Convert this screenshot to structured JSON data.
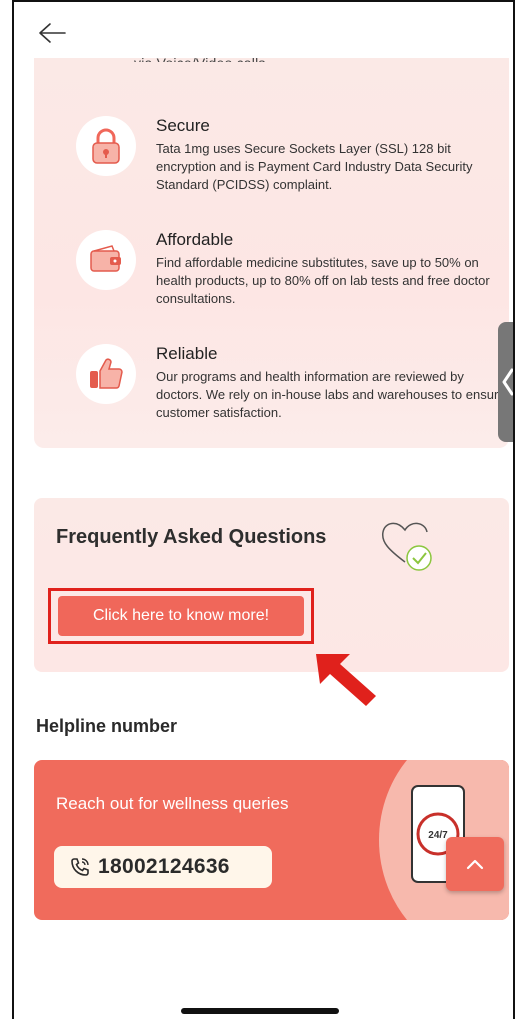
{
  "cutoff_text": "via Voice/Video calls.",
  "features": [
    {
      "icon": "lock-icon",
      "title": "Secure",
      "desc": "Tata 1mg uses Secure Sockets Layer (SSL) 128 bit encryption and is Payment Card Industry Data Security Standard (PCIDSS) complaint."
    },
    {
      "icon": "wallet-icon",
      "title": "Affordable",
      "desc": "Find affordable medicine substitutes, save up to 50% on health products, up to 80% off on lab tests and free doctor consultations."
    },
    {
      "icon": "thumbs-up-icon",
      "title": "Reliable",
      "desc": "Our programs and health information are reviewed by doctors. We rely on in-house labs and warehouses to ensure customer satisfaction."
    }
  ],
  "faq": {
    "title": "Frequently Asked Questions",
    "button_label": "Click here to know more!"
  },
  "helpline": {
    "title": "Helpline number",
    "tagline": "Reach out for wellness queries",
    "phone": "18002124636",
    "badge": "24/7"
  },
  "colors": {
    "accent": "#f06b5c",
    "card_bg": "#fbe9e6",
    "annotation": "#e0211c"
  }
}
